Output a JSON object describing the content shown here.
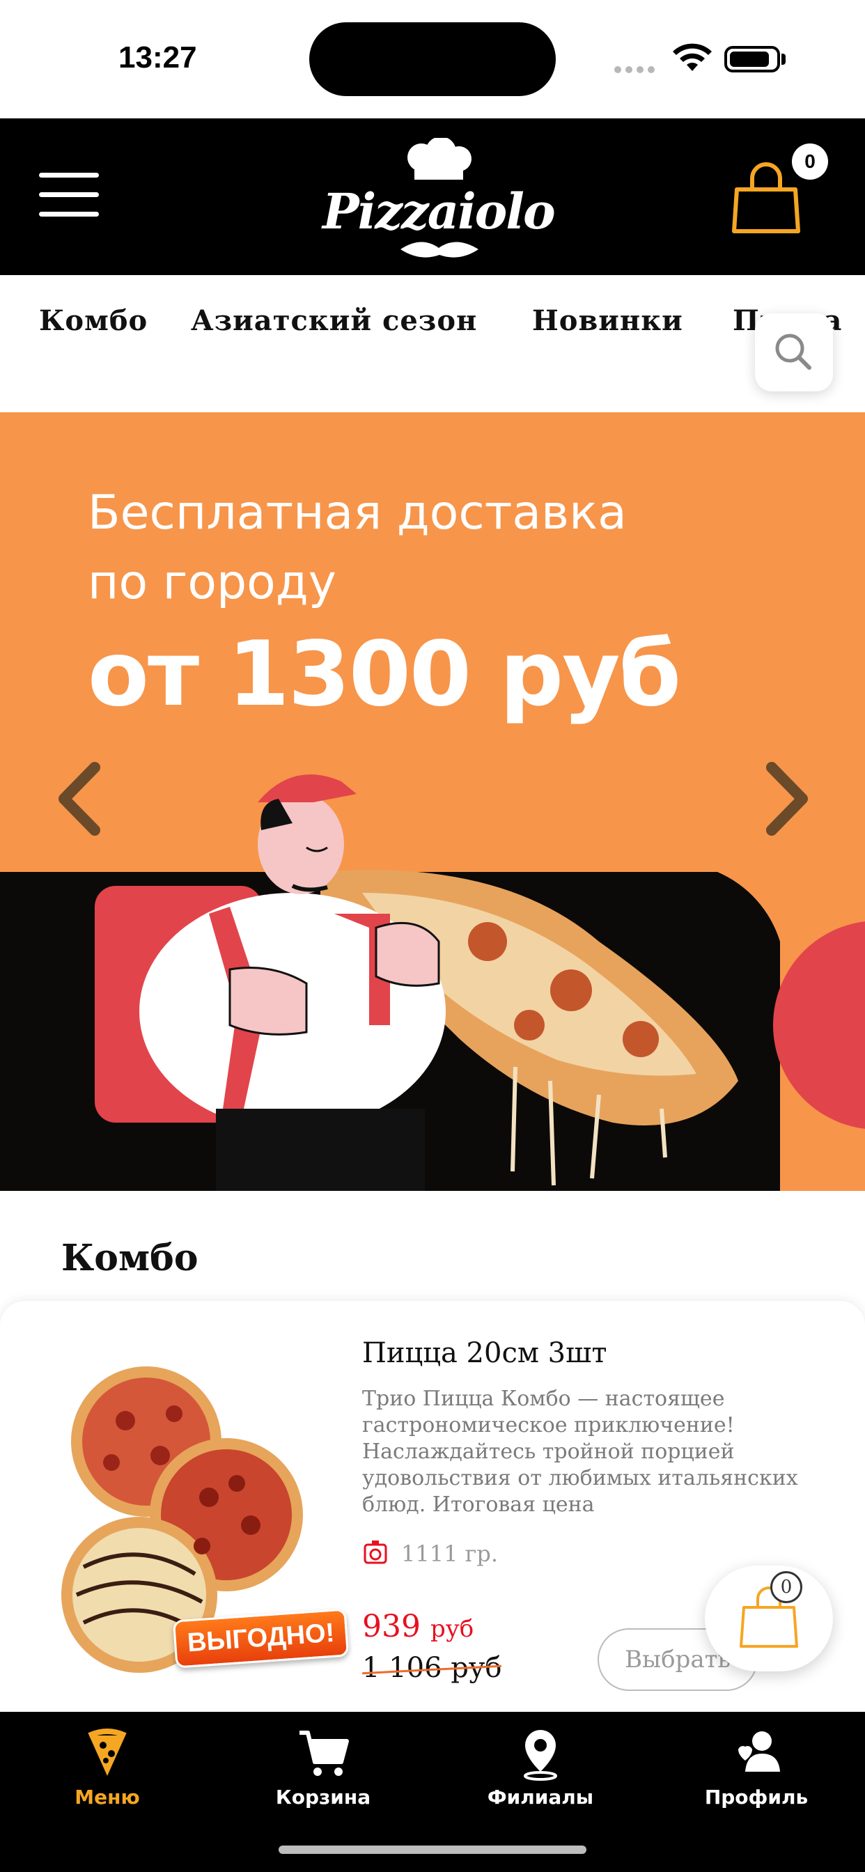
{
  "status_bar": {
    "time": "13:27"
  },
  "header": {
    "logo_text": "Pizzaiolo",
    "cart_count": "0"
  },
  "categories": [
    "Комбо",
    "Азиатский сезон",
    "Новинки",
    "Пицца"
  ],
  "banner": {
    "line1": "Бесплатная доставка",
    "line2": "по городу",
    "line3": "от 1300 руб"
  },
  "section": {
    "title": "Комбо"
  },
  "product": {
    "title": "Пицца 20см 3шт",
    "description": "Трио Пицца Комбо — настоящее гастрономическое приключение! Наслаждайтесь тройной порцией удовольствия от любимых итальянских блюд. Итоговая цена",
    "weight": "1111 гр.",
    "price_value": "939",
    "price_unit": "руб",
    "old_price": "1 106 руб",
    "badge": "ВЫГОДНО!",
    "select_label": "Выбрать"
  },
  "floating_cart": {
    "count": "0"
  },
  "tabbar": {
    "items": [
      {
        "label": "Меню",
        "icon": "pizza-slice-icon",
        "active": true
      },
      {
        "label": "Корзина",
        "icon": "cart-icon",
        "active": false
      },
      {
        "label": "Филиалы",
        "icon": "location-pin-icon",
        "active": false
      },
      {
        "label": "Профиль",
        "icon": "profile-icon",
        "active": false
      }
    ]
  },
  "colors": {
    "accent": "#f5a623",
    "banner_orange": "#f7954a",
    "price_red": "#e8101f",
    "header_bg": "#000000"
  }
}
